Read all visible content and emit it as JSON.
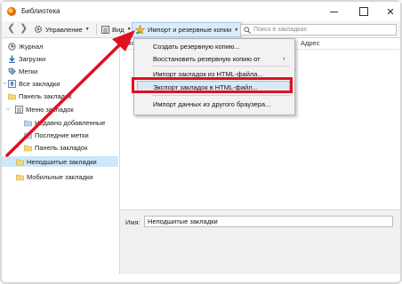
{
  "window": {
    "title": "Библиотека"
  },
  "toolbar": {
    "organize_label": "Управление",
    "view_label": "Вид",
    "import_label": "Импорт и резервные копии",
    "search_placeholder": "Поиск в закладках"
  },
  "tree": {
    "items": [
      {
        "label": "Журнал",
        "icon": "history-icon"
      },
      {
        "label": "Загрузки",
        "icon": "downloads-icon"
      },
      {
        "label": "Метки",
        "icon": "tags-icon"
      },
      {
        "label": "Все закладки",
        "icon": "all-bookmarks-icon"
      },
      {
        "label": "Панель закладок",
        "icon": "folder-icon"
      },
      {
        "label": "Меню закладок",
        "icon": "bookmarks-menu-icon"
      },
      {
        "label": "Недавно добавленные",
        "icon": "smart-folder-icon"
      },
      {
        "label": "Последние метки",
        "icon": "smart-folder-icon"
      },
      {
        "label": "Панель закладок",
        "icon": "folder-icon"
      },
      {
        "label": "Неподшитые закладки",
        "icon": "folder-icon"
      },
      {
        "label": "Мобильные закладки",
        "icon": "folder-icon"
      }
    ],
    "selected_index": 9
  },
  "columns": {
    "name": "Имя",
    "address": "Адрес"
  },
  "menu": {
    "items": [
      {
        "label": "Создать резервную копию...",
        "has_submenu": false
      },
      {
        "label": "Восстановить резервную копию от",
        "has_submenu": true
      },
      {
        "label": "Импорт закладок из HTML-файла...",
        "has_submenu": false
      },
      {
        "label": "Экспорт закладок в HTML-файл...",
        "has_submenu": false,
        "highlighted": true
      },
      {
        "label": "Импорт данных из другого браузера...",
        "has_submenu": false
      }
    ],
    "submenu_arrow": "›"
  },
  "details": {
    "name_label": "Имя:",
    "name_value": "Неподшитые закладки"
  },
  "colors": {
    "annotation_red": "#e01020",
    "highlight": "#dbe9f6",
    "selected": "#cde8fb"
  }
}
